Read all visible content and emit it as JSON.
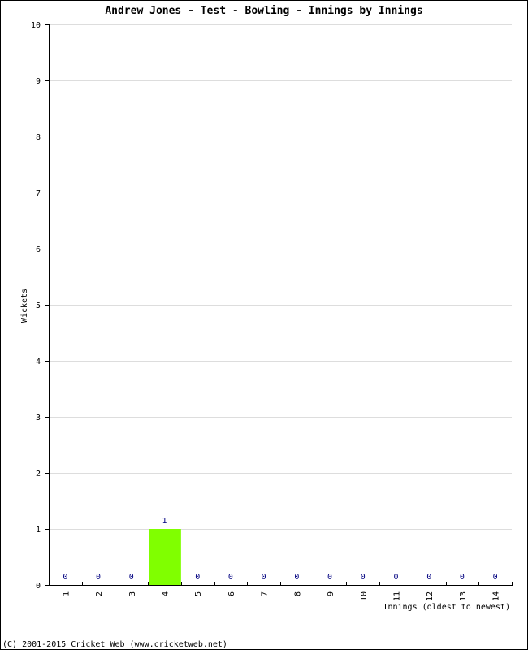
{
  "chart_data": {
    "type": "bar",
    "title": "Andrew Jones - Test - Bowling - Innings by Innings",
    "xlabel": "Innings (oldest to newest)",
    "ylabel": "Wickets",
    "categories": [
      "1",
      "2",
      "3",
      "4",
      "5",
      "6",
      "7",
      "8",
      "9",
      "10",
      "11",
      "12",
      "13",
      "14"
    ],
    "values": [
      0,
      0,
      0,
      1,
      0,
      0,
      0,
      0,
      0,
      0,
      0,
      0,
      0,
      0
    ],
    "ylim": [
      0,
      10
    ],
    "yticks": [
      0,
      1,
      2,
      3,
      4,
      5,
      6,
      7,
      8,
      9,
      10
    ],
    "grid": true,
    "colors": {
      "bar": "#80ff00",
      "data_label": "#000080",
      "grid": "#dddddd",
      "axis": "#000000"
    }
  },
  "footer": "(C) 2001-2015 Cricket Web (www.cricketweb.net)"
}
